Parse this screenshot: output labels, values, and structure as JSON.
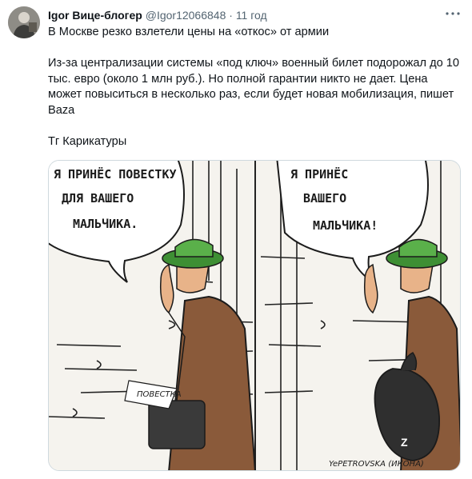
{
  "author": {
    "name": "Igor Вице-блогер",
    "handle": "@Igor12066848",
    "separator": "·",
    "time": "11 год"
  },
  "more_icon": "more-horizontal-icon",
  "tweet": {
    "line1": "В Москве резко взлетели цены на «откос» от армии",
    "line2": "Из-за централизации системы «под ключ» военный билет подорожал до 10 тыс. евро (около 1 млн руб.). Но полной гарантии никто не дает. Цена может повыситься в несколько раз, если будет новая мобилизация, пишет Baza",
    "line3": "Тг Карикатуры"
  },
  "cartoon": {
    "left_bubble": [
      "Я ПРИНЁС ПОВЕСТКУ",
      "ДЛЯ ВАШЕГО",
      "МАЛЬЧИКА."
    ],
    "right_bubble": [
      "Я ПРИНЁС",
      "ВАШЕГО",
      "МАЛЬЧИКА!"
    ],
    "bag_letter": "Z",
    "paper_text": "ПОВЕСТКА",
    "signature": "YePETROVSKA (ИКОНА)"
  },
  "colors": {
    "link_gray": "#536471",
    "coat": "#8a5a3a",
    "cap": "#4a9a3a",
    "bag": "#3a3a3a"
  }
}
